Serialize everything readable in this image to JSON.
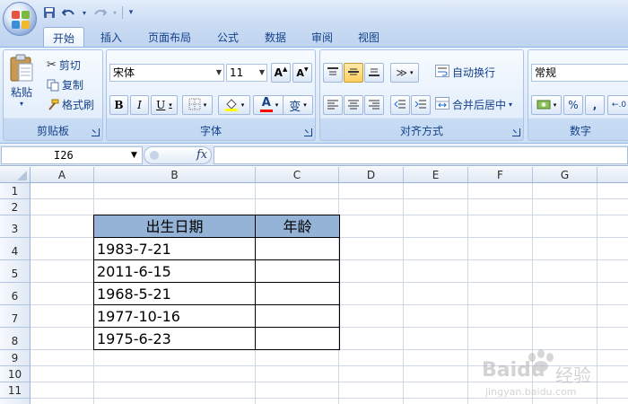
{
  "qat": {
    "save_icon": "save-icon",
    "undo_icon": "undo-icon",
    "redo_icon": "redo-icon"
  },
  "tabs": [
    "开始",
    "插入",
    "页面布局",
    "公式",
    "数据",
    "审阅",
    "视图"
  ],
  "clipboard": {
    "paste": "粘贴",
    "cut": "剪切",
    "copy": "复制",
    "format_painter": "格式刷",
    "label": "剪贴板"
  },
  "font": {
    "name": "宋体",
    "size": "11",
    "label": "字体",
    "bold": "B",
    "italic": "I",
    "underline": "U",
    "grow": "A",
    "shrink": "A",
    "color_letter": "A",
    "phonetic": "变"
  },
  "align": {
    "wrap": "自动换行",
    "merge": "合并后居中",
    "label": "对齐方式"
  },
  "number": {
    "format": "常规",
    "percent": "%",
    "comma": ",",
    "label": "数字"
  },
  "formula_bar": {
    "name_box": "I26",
    "fx": "fx",
    "value": ""
  },
  "columns": [
    "A",
    "B",
    "C",
    "D",
    "E",
    "F",
    "G"
  ],
  "rows": [
    "1",
    "2",
    "3",
    "4",
    "5",
    "6",
    "7",
    "8",
    "9",
    "10",
    "11"
  ],
  "table": {
    "headers": [
      "出生日期",
      "年龄"
    ],
    "rows": [
      [
        "1983-7-21",
        ""
      ],
      [
        "2011-6-15",
        ""
      ],
      [
        "1968-5-21",
        ""
      ],
      [
        "1977-10-16",
        ""
      ],
      [
        "1975-6-23",
        ""
      ]
    ]
  },
  "watermark": {
    "brand": "Bai",
    "brand2": "du",
    "suffix": "经验",
    "url": "jingyan.baidu.com"
  },
  "colors": {
    "header_fill": "#95b3d7",
    "ribbon_text": "#15428b",
    "font_color_bar": "#ff0000"
  }
}
